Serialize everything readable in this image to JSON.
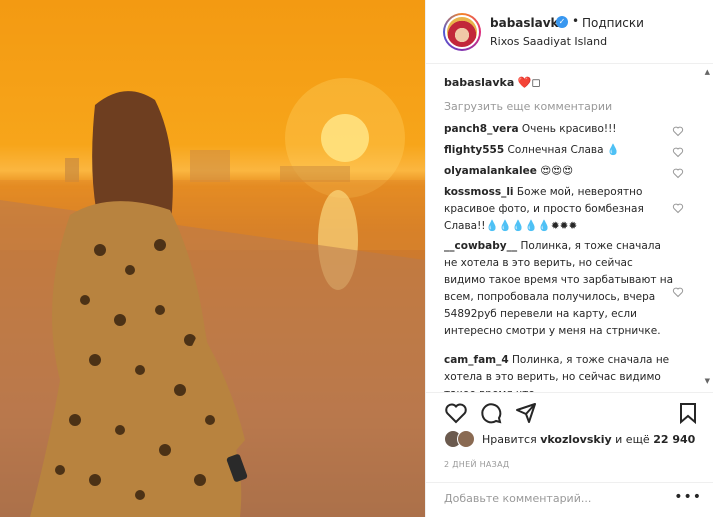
{
  "post": {
    "image_alt": "sunset-beach-photo",
    "header": {
      "username": "babaslavka",
      "separator": "•",
      "follow_label": "Подписки",
      "location": "Rixos Saadiyat Island"
    },
    "caption": {
      "username": "babaslavka",
      "text": "❤️◻"
    },
    "load_more_label": "Загрузить еще комментарии",
    "comments": [
      {
        "username": "panch8_vera",
        "text": "Очень красиво!!!"
      },
      {
        "username": "flighty555",
        "text": "Солнечная Слава 💧"
      },
      {
        "username": "olyamalankalee",
        "text": "😍😍😍"
      },
      {
        "username": "kossmoss_li",
        "text": "Боже мой, невероятно красивое фото, и просто бомбезная Слава!!💧💧💧💧💧✹✹✹"
      },
      {
        "username": "__cowbaby__",
        "text": "Полинка, я тоже сначала не хотела в это верить, но сейчас видимо такое время что зарбатывают на всем, попробовала получилось, вчера 54892руб перевели на карту, если интересно смотри у меня на стрничке."
      },
      {
        "username": "cam_fam_4",
        "text": "Полинка, я тоже сначала не хотела в это верить, но сейчас видимо такое время что"
      }
    ],
    "likes": {
      "prefix": "Нравится",
      "user": "vkozlovskiy",
      "middle": "и ещё",
      "count": "22 940"
    },
    "timestamp": "2 ДНЕЙ НАЗАД",
    "add_comment_placeholder": "Добавьте комментарий...",
    "more_label": "•••",
    "colors": {
      "accent": "#3897f0",
      "muted": "#999999",
      "text": "#262626"
    }
  }
}
